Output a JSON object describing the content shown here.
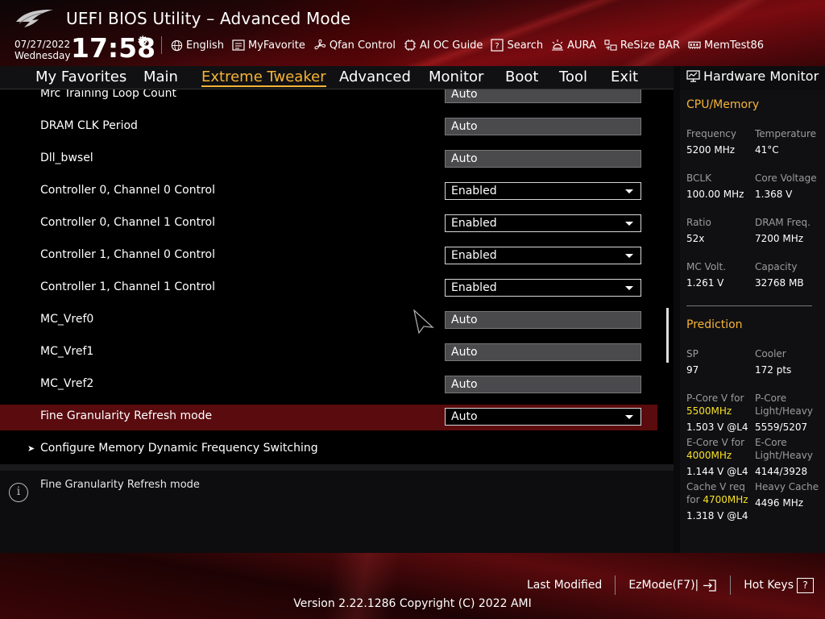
{
  "header": {
    "title": "UEFI BIOS Utility – Advanced Mode",
    "date": "07/27/2022",
    "day": "Wednesday",
    "time": "17:58",
    "toolbar": [
      {
        "label": "English",
        "icon": "globe-icon"
      },
      {
        "label": "MyFavorite",
        "icon": "favorite-list-icon"
      },
      {
        "label": "Qfan Control",
        "icon": "fan-icon"
      },
      {
        "label": "AI OC Guide",
        "icon": "ai-guide-icon"
      },
      {
        "label": "Search",
        "icon": "search-box-icon"
      },
      {
        "label": "AURA",
        "icon": "aura-light-icon"
      },
      {
        "label": "ReSize BAR",
        "icon": "resize-bar-icon"
      },
      {
        "label": "MemTest86",
        "icon": "memory-icon"
      }
    ]
  },
  "nav": {
    "tabs": [
      "My Favorites",
      "Main",
      "Extreme Tweaker",
      "Advanced",
      "Monitor",
      "Boot",
      "Tool",
      "Exit"
    ],
    "active": "Extreme Tweaker"
  },
  "settings": [
    {
      "label": "Mrc Training Loop Count",
      "value": "Auto",
      "type": "field"
    },
    {
      "label": "DRAM CLK Period",
      "value": "Auto",
      "type": "field"
    },
    {
      "label": "Dll_bwsel",
      "value": "Auto",
      "type": "field"
    },
    {
      "label": "Controller 0, Channel 0 Control",
      "value": "Enabled",
      "type": "dropdown"
    },
    {
      "label": "Controller 0, Channel 1 Control",
      "value": "Enabled",
      "type": "dropdown"
    },
    {
      "label": "Controller 1, Channel 0 Control",
      "value": "Enabled",
      "type": "dropdown"
    },
    {
      "label": "Controller 1, Channel 1 Control",
      "value": "Enabled",
      "type": "dropdown"
    },
    {
      "label": "MC_Vref0",
      "value": "Auto",
      "type": "field"
    },
    {
      "label": "MC_Vref1",
      "value": "Auto",
      "type": "field"
    },
    {
      "label": "MC_Vref2",
      "value": "Auto",
      "type": "field"
    },
    {
      "label": "Fine Granularity Refresh mode",
      "value": "Auto",
      "type": "dropdown",
      "selected": true
    }
  ],
  "submenu": {
    "label": "Configure Memory Dynamic Frequency Switching"
  },
  "help": {
    "text": "Fine Granularity Refresh mode"
  },
  "hardware_monitor": {
    "title": "Hardware Monitor",
    "cpu_memory": {
      "heading": "CPU/Memory",
      "items": [
        {
          "label": "Frequency",
          "value": "5200 MHz"
        },
        {
          "label": "Temperature",
          "value": "41°C"
        },
        {
          "label": "BCLK",
          "value": "100.00 MHz"
        },
        {
          "label": "Core Voltage",
          "value": "1.368 V"
        },
        {
          "label": "Ratio",
          "value": "52x"
        },
        {
          "label": "DRAM Freq.",
          "value": "7200 MHz"
        },
        {
          "label": "MC Volt.",
          "value": "1.261 V"
        },
        {
          "label": "Capacity",
          "value": "32768 MB"
        }
      ]
    },
    "prediction": {
      "heading": "Prediction",
      "sp_label": "SP",
      "sp_value": "97",
      "cooler_label": "Cooler",
      "cooler_value": "172 pts",
      "pcore_label": "P-Core V for",
      "pcore_freq": "5500MHz",
      "pcore_value": "1.503 V @L4",
      "pcore_lh_label_1": "P-Core",
      "pcore_lh_label_2": "Light/Heavy",
      "pcore_lh_value": "5559/5207",
      "ecore_label": "E-Core V for",
      "ecore_freq": "4000MHz",
      "ecore_value": "1.144 V @L4",
      "ecore_lh_label_1": "E-Core",
      "ecore_lh_label_2": "Light/Heavy",
      "ecore_lh_value": "4144/3928",
      "cache_label": "Cache V req",
      "cache_for": "for",
      "cache_freq": "4700MHz",
      "cache_value": "1.318 V @L4",
      "heavy_cache_label": "Heavy Cache",
      "heavy_cache_value": "4496 MHz"
    }
  },
  "footer": {
    "last_modified": "Last Modified",
    "ezmode": "EzMode(F7)|",
    "hotkeys": "Hot Keys",
    "hotkeys_key": "?",
    "version": "Version 2.22.1286 Copyright (C) 2022 AMI"
  },
  "colors": {
    "accent": "#f7b436",
    "highlight": "#f7e026",
    "selected_row": "#5a0b0e"
  }
}
